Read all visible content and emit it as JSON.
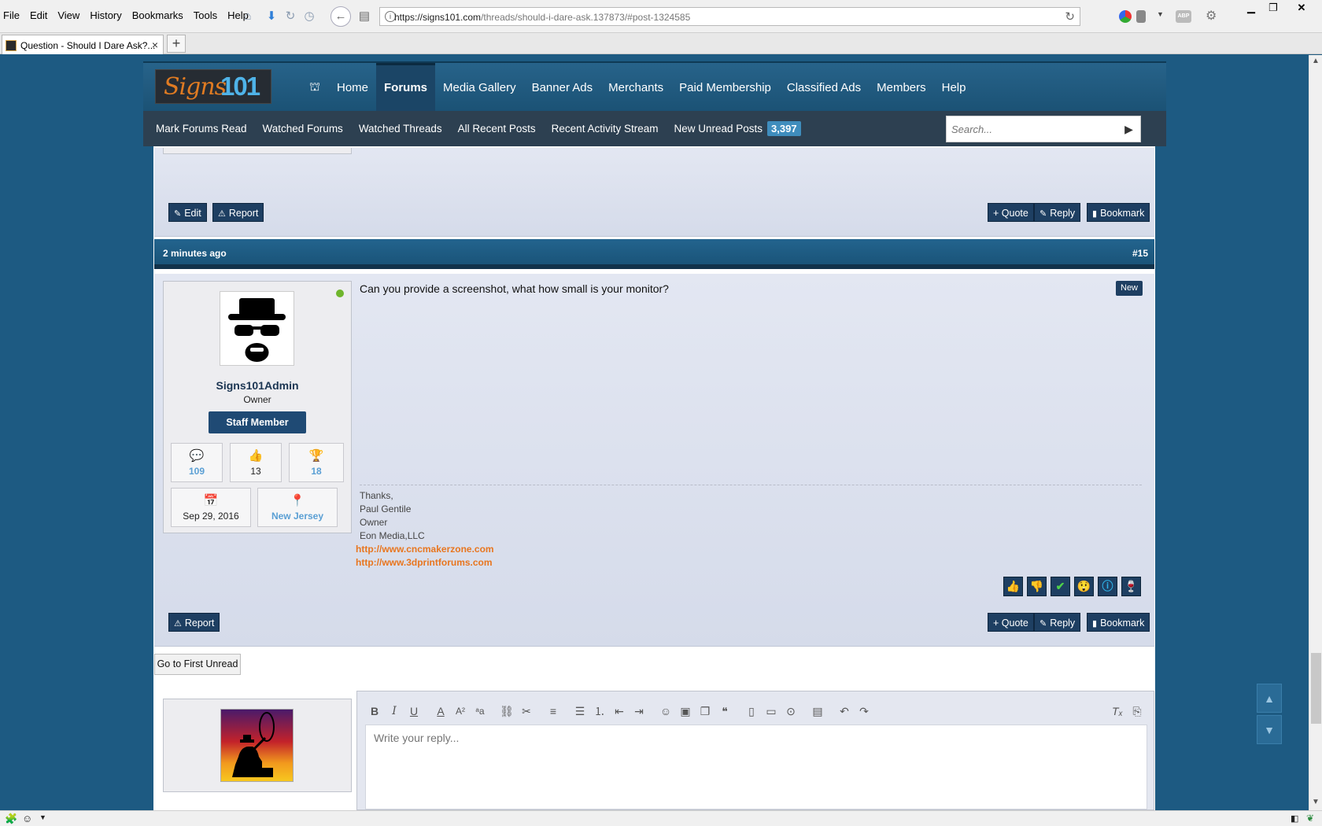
{
  "browser": {
    "menus": [
      "File",
      "Edit",
      "View",
      "History",
      "Bookmarks",
      "Tools",
      "Help"
    ],
    "url_host": "https://signs101.com",
    "url_path": "/threads/should-i-dare-ask.137873/#post-1324585",
    "tab_title": "Question - Should I Dare Ask?...",
    "tab_close": "×",
    "new_tab": "+",
    "ext_label": "ABP"
  },
  "site": {
    "logo_script": "Signs",
    "logo_num": "101",
    "nav": [
      "Home",
      "Forums",
      "Media Gallery",
      "Banner Ads",
      "Merchants",
      "Paid Membership",
      "Classified Ads",
      "Members",
      "Help"
    ],
    "active_nav": "Forums",
    "subnav": [
      "Mark Forums Read",
      "Watched Forums",
      "Watched Threads",
      "All Recent Posts",
      "Recent Activity Stream",
      "New Unread Posts"
    ],
    "unread_count": "3,397",
    "search_placeholder": "Search..."
  },
  "prev_post": {
    "edit": "Edit",
    "report": "Report",
    "quote": "+ Quote",
    "reply": "Reply",
    "bookmark": "Bookmark"
  },
  "post": {
    "time": "2 minutes ago",
    "number": "#15",
    "new_badge": "New",
    "message": "Can you provide a screenshot, what how small is your monitor?",
    "user": {
      "name": "Signs101Admin",
      "title": "Owner",
      "badge": "Staff Member",
      "messages": "109",
      "likes": "13",
      "trophies": "18",
      "joined": "Sep 29, 2016",
      "location": "New Jersey"
    },
    "signature": [
      "Thanks,",
      "Paul Gentile",
      "Owner",
      "Eon Media,LLC"
    ],
    "links": [
      "http://www.cncmakerzone.com",
      "http://www.3dprintforums.com"
    ],
    "report": "Report",
    "quote": "+ Quote",
    "reply": "Reply",
    "bookmark": "Bookmark"
  },
  "go_first_unread": "Go to First Unread",
  "editor": {
    "placeholder": "Write your reply..."
  },
  "colors": {
    "page_bg": "#1d5a82",
    "button_bg": "#1e3f62",
    "link_orange": "#e8761f",
    "link_blue": "#5a9fd4"
  }
}
